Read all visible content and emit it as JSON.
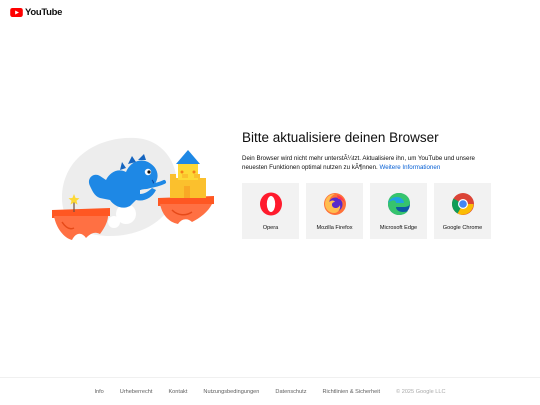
{
  "header": {
    "logo_text": "YouTube",
    "logo_icon": "youtube-play-icon",
    "brand_color": "#ff0000"
  },
  "main": {
    "headline": "Bitte aktualisiere deinen Browser",
    "description": "Dein Browser wird nicht mehr unterstÃ¼tzt. Aktualisiere ihn, um YouTube und unsere neuesten Funktionen optimal nutzen zu kÃ¶nnen.",
    "more_info_link": "Weitere Informationen",
    "link_color": "#065fd4"
  },
  "browsers": [
    {
      "label": "Opera",
      "icon": "opera-icon"
    },
    {
      "label": "Mozilla Firefox",
      "icon": "firefox-icon"
    },
    {
      "label": "Microsoft Edge",
      "icon": "edge-icon"
    },
    {
      "label": "Google Chrome",
      "icon": "chrome-icon"
    }
  ],
  "footer": {
    "links": [
      "Info",
      "Urheberrecht",
      "Kontakt",
      "Nutzungsbedingungen",
      "Datenschutz",
      "Richtlinien & Sicherheit"
    ],
    "copyright": "© 2025 Google LLC"
  }
}
